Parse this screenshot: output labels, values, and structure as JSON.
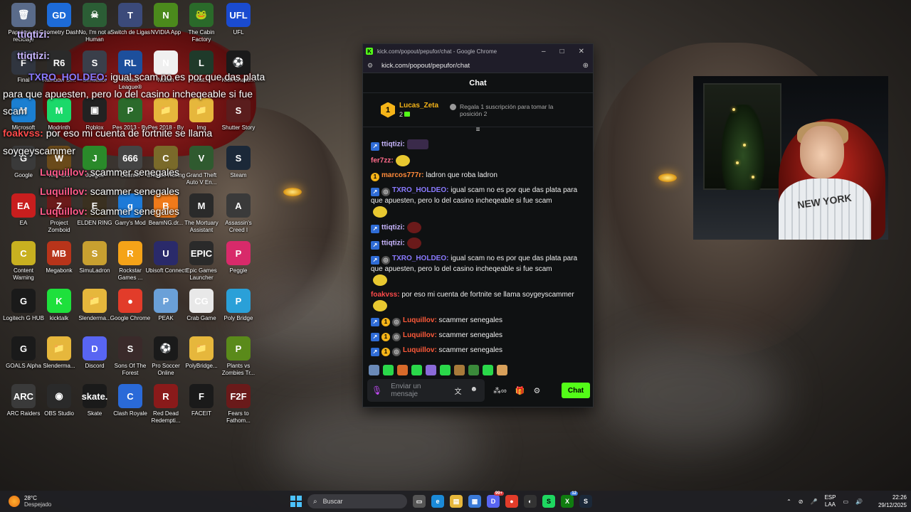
{
  "desktop_icons": [
    {
      "label": "Papelera de reciclaje",
      "color": "#5a6b8a",
      "glyph": "🗑"
    },
    {
      "label": "Geometry Dash",
      "color": "#1d6bd8",
      "glyph": "GD"
    },
    {
      "label": "No, I'm not a Human",
      "color": "#2b5d35",
      "glyph": "☠"
    },
    {
      "label": "Switch de Ligas",
      "color": "#3b4a7a",
      "glyph": "T"
    },
    {
      "label": "NVIDIA App",
      "color": "#4b8a1c",
      "glyph": "N"
    },
    {
      "label": "The Cabin Factory",
      "color": "#2a6a2a",
      "glyph": "🐸"
    },
    {
      "label": "UFL",
      "color": "#1a4bd0",
      "glyph": "UFL"
    },
    {
      "label": "Final",
      "color": "#30353f",
      "glyph": "F"
    },
    {
      "label": "Rainbow Si...",
      "color": "#2a2a2a",
      "glyph": "R6"
    },
    {
      "label": "Simulator",
      "color": "#3a3f4a",
      "glyph": "S"
    },
    {
      "label": "Rocket League®",
      "color": "#1d4f9c",
      "glyph": "RL"
    },
    {
      "label": "Notion",
      "color": "#f0f0f0",
      "glyph": "N"
    },
    {
      "label": "Lost...",
      "color": "#1f3a2a",
      "glyph": "L"
    },
    {
      "label": "Kick Challe...",
      "color": "#1a1a1a",
      "glyph": "⚽"
    },
    {
      "label": "Microsoft",
      "color": "#1b7fd1",
      "glyph": "M"
    },
    {
      "label": "Modrinth",
      "color": "#1bd96a",
      "glyph": "M"
    },
    {
      "label": "Roblox",
      "color": "#222222",
      "glyph": "▣"
    },
    {
      "label": "Pes 2013 - By",
      "color": "#2b6a2b",
      "glyph": "P"
    },
    {
      "label": "Pes 2018 - By",
      "color": "#e6b73c",
      "glyph": "📁"
    },
    {
      "label": "Img",
      "color": "#e6b73c",
      "glyph": "📁"
    },
    {
      "label": "Shutter Story",
      "color": "#5a1d1d",
      "glyph": "S"
    },
    {
      "label": "Google",
      "color": "#3a3a3a",
      "glyph": "G"
    },
    {
      "label": "Way Out",
      "color": "#6a4a1a",
      "glyph": "W"
    },
    {
      "label": "Juegos",
      "color": "#2a8a2a",
      "glyph": "J"
    },
    {
      "label": "Counter",
      "color": "#444444",
      "glyph": "666"
    },
    {
      "label": "Cheese Rolling",
      "color": "#7a6a2a",
      "glyph": "C"
    },
    {
      "label": "Grand Theft Auto V En...",
      "color": "#2f5a2f",
      "glyph": "V"
    },
    {
      "label": "Steam",
      "color": "#1b2838",
      "glyph": "S"
    },
    {
      "label": "EA",
      "color": "#c81e1e",
      "glyph": "EA"
    },
    {
      "label": "Project Zomboid",
      "color": "#6a1a1a",
      "glyph": "Z"
    },
    {
      "label": "ELDEN RING",
      "color": "#3a3020",
      "glyph": "E"
    },
    {
      "label": "Garry's Mod",
      "color": "#1d7ad8",
      "glyph": "g"
    },
    {
      "label": "BeamNG.dr...",
      "color": "#f07a1a",
      "glyph": "B"
    },
    {
      "label": "The Mortuary Assistant",
      "color": "#2a2a2a",
      "glyph": "M"
    },
    {
      "label": "Assassin's Creed I",
      "color": "#3a3a3a",
      "glyph": "A"
    },
    {
      "label": "Content Warning",
      "color": "#c8b020",
      "glyph": "C"
    },
    {
      "label": "Megabonk",
      "color": "#b8341a",
      "glyph": "MB"
    },
    {
      "label": "SimuLadron",
      "color": "#c8a030",
      "glyph": "S"
    },
    {
      "label": "Rockstar Games ...",
      "color": "#f5a318",
      "glyph": "R"
    },
    {
      "label": "Ubisoft Connect",
      "color": "#2a2a6a",
      "glyph": "U"
    },
    {
      "label": "Epic Games Launcher",
      "color": "#2a2a2a",
      "glyph": "EPIC"
    },
    {
      "label": "Peggle",
      "color": "#d82a6a",
      "glyph": "P"
    },
    {
      "label": "Logitech G HUB",
      "color": "#1a1a1a",
      "glyph": "G"
    },
    {
      "label": "kicktalk",
      "color": "#1ee03c",
      "glyph": "K"
    },
    {
      "label": "Slenderma...",
      "color": "#e6b73c",
      "glyph": "📁"
    },
    {
      "label": "Google Chrome",
      "color": "#e23c2a",
      "glyph": "●"
    },
    {
      "label": "PEAK",
      "color": "#6aa0d8",
      "glyph": "P"
    },
    {
      "label": "Crab Game",
      "color": "#e8e8e8",
      "glyph": "CG"
    },
    {
      "label": "Poly Bridge",
      "color": "#2aa0d8",
      "glyph": "P"
    },
    {
      "label": "GOALS Alpha",
      "color": "#1a1a1a",
      "glyph": "G"
    },
    {
      "label": "Slenderma...",
      "color": "#e6b73c",
      "glyph": "📁"
    },
    {
      "label": "Discord",
      "color": "#5865f2",
      "glyph": "D"
    },
    {
      "label": "Sons Of The Forest",
      "color": "#3a2a2a",
      "glyph": "S"
    },
    {
      "label": "Pro Soccer Online",
      "color": "#1a1a1a",
      "glyph": "⚽"
    },
    {
      "label": "PolyBridge...",
      "color": "#e6b73c",
      "glyph": "📁"
    },
    {
      "label": "Plants vs Zombies Tr...",
      "color": "#5a8a1a",
      "glyph": "P"
    },
    {
      "label": "ARC Raiders",
      "color": "#3a3a3a",
      "glyph": "ARC"
    },
    {
      "label": "OBS Studio",
      "color": "#2a2a2a",
      "glyph": "◉"
    },
    {
      "label": "Skate",
      "color": "#1a1a1a",
      "glyph": "skate."
    },
    {
      "label": "Clash Royale",
      "color": "#2a6ad8",
      "glyph": "C"
    },
    {
      "label": "Red Dead Redempti...",
      "color": "#8a1a1a",
      "glyph": "R"
    },
    {
      "label": "FACEIT",
      "color": "#1a1a1a",
      "glyph": "F"
    },
    {
      "label": "Fears to Fathom...",
      "color": "#6a1a1a",
      "glyph": "F2F"
    }
  ],
  "overlay": {
    "l1_name": "ttiqtizi:",
    "l2_name": "ttiqtizi:",
    "l3_name": "TXRO_HOLDEO:",
    "l3_text": " igual scam no es por que das plata",
    "l3b": "para que apuesten, pero lo del casino incheqeable si fue",
    "l3c": "scam",
    "l4_name": "foakvss:",
    "l4_text": " por eso mi cuenta de fortnite se llama",
    "l4b": "soygeyscammer",
    "l5_name": "Luquillov:",
    "l5_text": " scammer senegales",
    "l6_name": "Luquillov:",
    "l6_text": " scammer senegales",
    "l7_name": "Luquillov:",
    "l7_text": " scammer senegales"
  },
  "browser": {
    "title": "kick.com/popout/pepufor/chat - Google Chrome",
    "url": "kick.com/popout/pepufor/chat"
  },
  "chat": {
    "header": "Chat",
    "pinned_user": "Lucas_Zeta",
    "pinned_rank": "1",
    "pinned_count": "2",
    "gift_text": "Regala 1 suscripción para tomar la posición 2",
    "messages": [
      {
        "user": "ttiqtizi:",
        "color": "#c9b6ff",
        "text": "",
        "badges": [
          "pin"
        ],
        "emote": "sq"
      },
      {
        "user": "fer7zz:",
        "color": "#ff6b8a",
        "text": "",
        "badges": [],
        "emote": "round"
      },
      {
        "user": "marcos777r:",
        "color": "#ff8a3a",
        "text": " ladron que roba ladron",
        "badges": [
          "gold"
        ],
        "emote": ""
      },
      {
        "user": "TXRO_HOLDEO:",
        "color": "#8a7aff",
        "text": " igual scam no es por que das plata para que apuesten, pero lo del casino incheqeable si fue scam",
        "badges": [
          "pin",
          "grey"
        ],
        "emote": "round"
      },
      {
        "user": "ttiqtizi:",
        "color": "#c9b6ff",
        "text": "",
        "badges": [
          "pin"
        ],
        "emote": "round"
      },
      {
        "user": "ttiqtizi:",
        "color": "#c9b6ff",
        "text": "",
        "badges": [
          "pin"
        ],
        "emote": "round"
      },
      {
        "user": "TXRO_HOLDEO:",
        "color": "#8a7aff",
        "text": " igual scam no es por que das plata para que apuesten, pero lo del casino incheqeable si fue scam",
        "badges": [
          "pin",
          "grey"
        ],
        "emote": "round"
      },
      {
        "user": "foakvss:",
        "color": "#ff4a4a",
        "text": " por eso mi cuenta de fortnite se llama soygeyscammer",
        "badges": [],
        "emote": "round"
      },
      {
        "user": "Luquillov:",
        "color": "#ff5a3a",
        "text": " scammer senegales",
        "badges": [
          "pin",
          "gold",
          "grey"
        ],
        "emote": ""
      },
      {
        "user": "Luquillov:",
        "color": "#ff5a3a",
        "text": " scammer senegales",
        "badges": [
          "pin",
          "gold",
          "grey"
        ],
        "emote": ""
      },
      {
        "user": "Luquillov:",
        "color": "#ff5a3a",
        "text": " scammer senegales",
        "badges": [
          "pin",
          "gold",
          "grey"
        ],
        "emote": ""
      }
    ],
    "input_placeholder": "Enviar un mensaje",
    "send_label": "Chat"
  },
  "taskbar": {
    "temp": "28°C",
    "condition": "Despejado",
    "search_placeholder": "Buscar",
    "lang": "ESP",
    "lang2": "LAA",
    "time": "22:26",
    "date": "29/12/2025",
    "discord_badge": "99+",
    "xbox_badge": "12"
  },
  "webcam": {
    "shirt_text": "NEW YORK"
  },
  "colors": {
    "kick_green": "#53fc18",
    "gold": "#f5b418"
  }
}
